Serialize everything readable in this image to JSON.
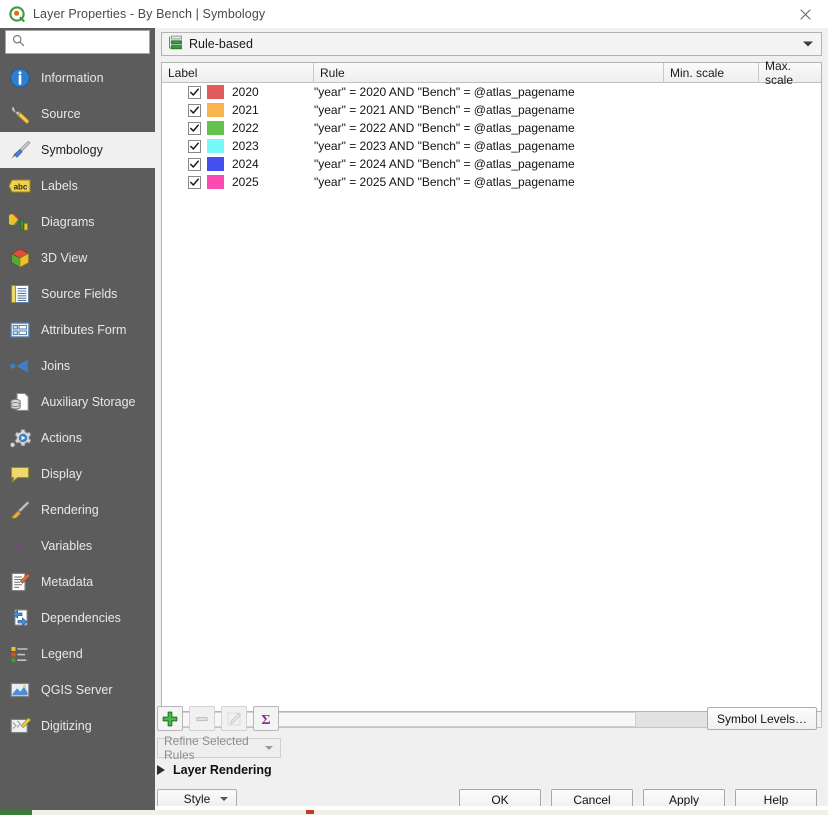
{
  "window": {
    "title": "Layer Properties - By Bench | Symbology",
    "icon": "qgis-logo-icon",
    "close_label": "✕"
  },
  "sidebar": {
    "search": {
      "value": "",
      "placeholder": "",
      "icon": "search-icon"
    },
    "items": [
      {
        "label": "Information",
        "icon": "information-icon",
        "selected": false
      },
      {
        "label": "Source",
        "icon": "source-wrench-icon",
        "selected": false
      },
      {
        "label": "Symbology",
        "icon": "symbology-brush-icon",
        "selected": true
      },
      {
        "label": "Labels",
        "icon": "labels-abc-icon",
        "selected": false
      },
      {
        "label": "Diagrams",
        "icon": "diagrams-chart-icon",
        "selected": false
      },
      {
        "label": "3D View",
        "icon": "3d-view-cube-icon",
        "selected": false
      },
      {
        "label": "Source Fields",
        "icon": "source-fields-icon",
        "selected": false
      },
      {
        "label": "Attributes Form",
        "icon": "attributes-form-icon",
        "selected": false
      },
      {
        "label": "Joins",
        "icon": "joins-icon",
        "selected": false
      },
      {
        "label": "Auxiliary Storage",
        "icon": "auxiliary-storage-icon",
        "selected": false
      },
      {
        "label": "Actions",
        "icon": "actions-gear-icon",
        "selected": false
      },
      {
        "label": "Display",
        "icon": "display-balloon-icon",
        "selected": false
      },
      {
        "label": "Rendering",
        "icon": "rendering-broom-icon",
        "selected": false
      },
      {
        "label": "Variables",
        "icon": "variables-epsilon-icon",
        "selected": false
      },
      {
        "label": "Metadata",
        "icon": "metadata-pencil-icon",
        "selected": false
      },
      {
        "label": "Dependencies",
        "icon": "dependencies-icon",
        "selected": false
      },
      {
        "label": "Legend",
        "icon": "legend-icon",
        "selected": false
      },
      {
        "label": "QGIS Server",
        "icon": "qgis-server-icon",
        "selected": false
      },
      {
        "label": "Digitizing",
        "icon": "digitizing-pencil-icon",
        "selected": false
      }
    ]
  },
  "renderer": {
    "selected": "Rule-based",
    "icon": "rule-based-icon",
    "options": [
      "Rule-based"
    ]
  },
  "rules_table": {
    "columns": [
      "Label",
      "Rule",
      "Min. scale",
      "Max. scale"
    ],
    "rows": [
      {
        "checked": true,
        "color": "#e05b5b",
        "label": "2020",
        "rule": "\"year\" = 2020 AND  \"Bench\" = @atlas_pagename",
        "min_scale": "",
        "max_scale": ""
      },
      {
        "checked": true,
        "color": "#f9b44e",
        "label": "2021",
        "rule": "\"year\" = 2021 AND  \"Bench\" = @atlas_pagename",
        "min_scale": "",
        "max_scale": ""
      },
      {
        "checked": true,
        "color": "#63c24e",
        "label": "2022",
        "rule": "\"year\" = 2022 AND  \"Bench\" = @atlas_pagename",
        "min_scale": "",
        "max_scale": ""
      },
      {
        "checked": true,
        "color": "#78f9f9",
        "label": "2023",
        "rule": "\"year\" = 2023 AND  \"Bench\" = @atlas_pagename",
        "min_scale": "",
        "max_scale": ""
      },
      {
        "checked": true,
        "color": "#4350ef",
        "label": "2024",
        "rule": "\"year\" = 2024 AND  \"Bench\" = @atlas_pagename",
        "min_scale": "",
        "max_scale": ""
      },
      {
        "checked": true,
        "color": "#fc4bb0",
        "label": "2025",
        "rule": "\"year\" = 2025 AND  \"Bench\" = @atlas_pagename",
        "min_scale": "",
        "max_scale": ""
      }
    ]
  },
  "toolbar": {
    "add": {
      "name": "add-rule-button",
      "icon": "green-plus-icon",
      "enabled": true
    },
    "remove": {
      "name": "remove-rule-button",
      "icon": "minus-icon",
      "enabled": false
    },
    "edit": {
      "name": "edit-rule-button",
      "icon": "pencil-icon",
      "enabled": false
    },
    "count": {
      "name": "count-features-button",
      "icon": "sigma-icon",
      "enabled": true
    },
    "refine_label": "Refine Selected Rules",
    "symbol_levels_label": "Symbol Levels…"
  },
  "layer_rendering": {
    "label": "Layer Rendering",
    "expanded": false
  },
  "style_button": {
    "label": "Style"
  },
  "dialog_buttons": [
    {
      "label": "OK"
    },
    {
      "label": "Cancel"
    },
    {
      "label": "Apply"
    },
    {
      "label": "Help"
    }
  ],
  "colors": {
    "sidebar_bg": "#5c5c5c",
    "selected_bg": "#f0f0f0",
    "dialog_bg": "#f0f0f0",
    "accent_green": "#2d9c3e",
    "accent_purple": "#8c2f8c"
  }
}
